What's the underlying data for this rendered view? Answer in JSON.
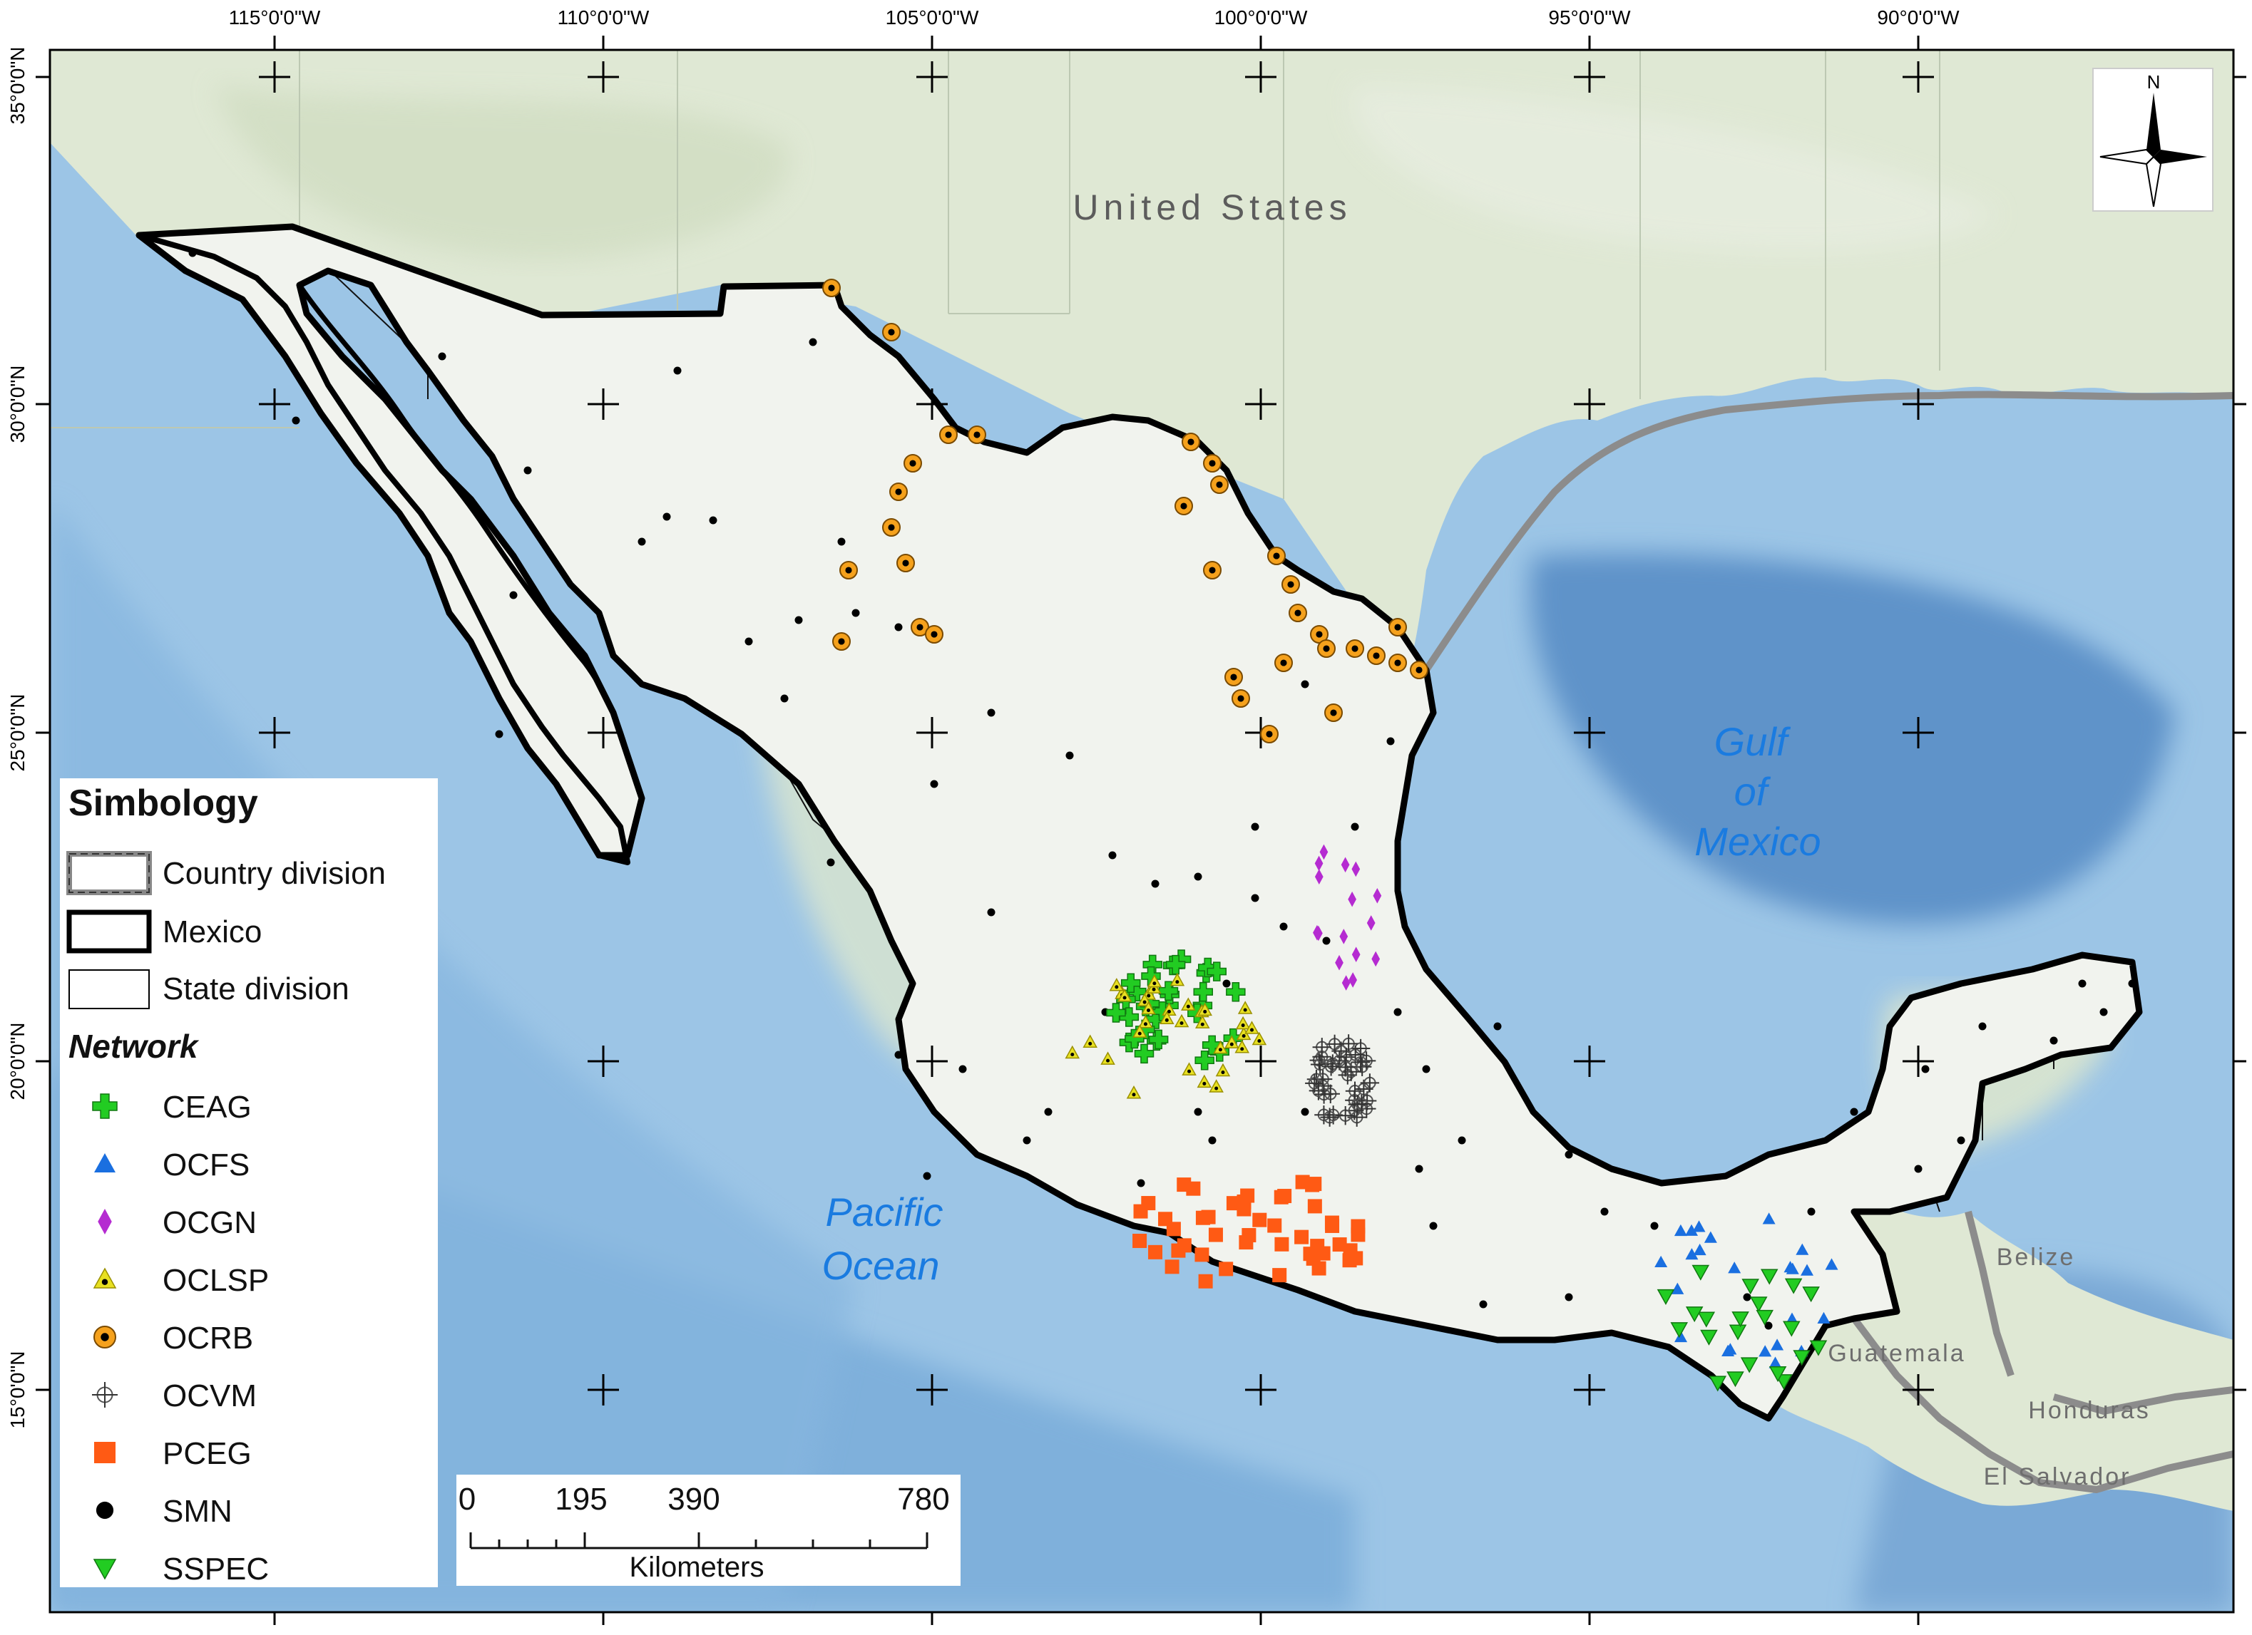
{
  "coordinates": {
    "lon_labels": [
      "115°0'0\"W",
      "110°0'0\"W",
      "105°0'0\"W",
      "100°0'0\"W",
      "95°0'0\"W",
      "90°0'0\"W"
    ],
    "lat_labels": [
      "35°0'0\"N",
      "30°0'0\"N",
      "25°0'0\"N",
      "20°0'0\"N",
      "15°0'0\"N"
    ]
  },
  "place_labels": {
    "united_states": "United States",
    "gulf_line1": "Gulf",
    "gulf_line2": "of",
    "gulf_line3": "Mexico",
    "pacific_line1": "Pacific",
    "pacific_line2": "Ocean",
    "belize": "Belize",
    "guatemala": "Guatemala",
    "honduras": "Honduras",
    "el_salvador": "El Salvador"
  },
  "north_arrow": {
    "label": "N"
  },
  "legend": {
    "title": "Simbology",
    "boundaries": [
      {
        "label": "Country division"
      },
      {
        "label": "Mexico"
      },
      {
        "label": "State division"
      }
    ],
    "network_title": "Network",
    "networks": [
      {
        "label": "CEAG",
        "symbol": "cross",
        "color": "#22cc22"
      },
      {
        "label": "OCFS",
        "symbol": "triangle",
        "color": "#1a6fe0"
      },
      {
        "label": "OCGN",
        "symbol": "diamond",
        "color": "#b52bd1"
      },
      {
        "label": "OCLSP",
        "symbol": "triangle-dot",
        "color": "#e8e022"
      },
      {
        "label": "OCRB",
        "symbol": "ring-dot",
        "color": "#f5a11c"
      },
      {
        "label": "OCVM",
        "symbol": "crosshair-circle",
        "color": "#666666"
      },
      {
        "label": "PCEG",
        "symbol": "square",
        "color": "#ff5a14"
      },
      {
        "label": "SMN",
        "symbol": "dot",
        "color": "#000000"
      },
      {
        "label": "SSPEC",
        "symbol": "triangle-down",
        "color": "#22cc22"
      }
    ]
  },
  "scale_bar": {
    "ticks": [
      "0",
      "195",
      "390",
      "780"
    ],
    "unit": "Kilometers"
  },
  "colors": {
    "ocean": "#9cc5e6",
    "deep_ocean": "#5f93c9",
    "land_context": "#dfe8d4",
    "mexico_land": "#f1f3ee",
    "border": "#000000",
    "label_blue": "#1a7be0"
  }
}
